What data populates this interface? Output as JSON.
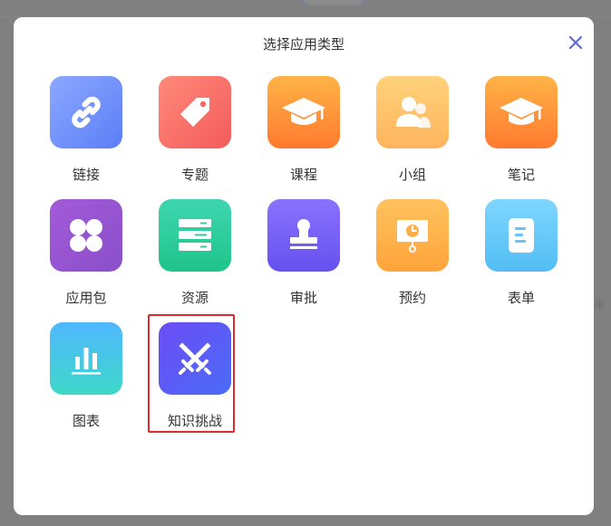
{
  "modal": {
    "title": "选择应用类型",
    "close_icon": "close-icon",
    "accent": "#5b6bd8"
  },
  "background": {
    "side_text": "耒"
  },
  "app_types": [
    {
      "label": "链接",
      "icon": "link-icon",
      "gradient": [
        "#8ca8ff",
        "#5b7ef6"
      ]
    },
    {
      "label": "专题",
      "icon": "tag-icon",
      "gradient": [
        "#ff8a7a",
        "#f45b5b"
      ]
    },
    {
      "label": "课程",
      "icon": "graduation-cap-icon",
      "gradient": [
        "#ffb347",
        "#ff7a2e"
      ]
    },
    {
      "label": "小组",
      "icon": "group-users-icon",
      "gradient": [
        "#ffd27a",
        "#ffb45e"
      ]
    },
    {
      "label": "笔记",
      "icon": "graduation-cap-icon",
      "gradient": [
        "#ffb347",
        "#ff7a2e"
      ]
    },
    {
      "label": "应用包",
      "icon": "four-petal-icon",
      "gradient": [
        "#a35ad8",
        "#8a4fc9"
      ]
    },
    {
      "label": "资源",
      "icon": "server-icon",
      "gradient": [
        "#3ed6b0",
        "#20c48a"
      ]
    },
    {
      "label": "审批",
      "icon": "stamp-icon",
      "gradient": [
        "#8a72ff",
        "#6651ef"
      ]
    },
    {
      "label": "预约",
      "icon": "presentation-clock-icon",
      "gradient": [
        "#ffc25e",
        "#ffa43a"
      ]
    },
    {
      "label": "表单",
      "icon": "document-icon",
      "gradient": [
        "#7fd6ff",
        "#52bdf5"
      ]
    },
    {
      "label": "图表",
      "icon": "bar-chart-icon",
      "gradient": [
        "#4fb8ff",
        "#3ed8c8"
      ]
    },
    {
      "label": "知识挑战",
      "icon": "crossed-swords-icon",
      "gradient": [
        "#6c4cf5",
        "#4a6cf7"
      ],
      "selected": true
    }
  ]
}
